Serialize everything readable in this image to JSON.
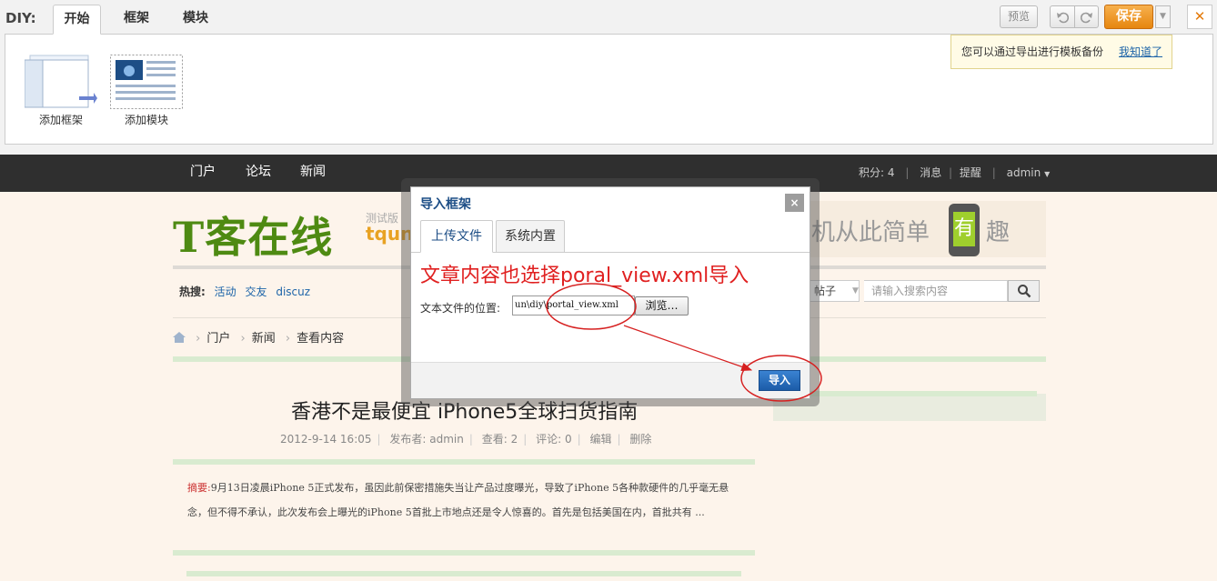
{
  "diy": {
    "label": "DIY:",
    "tabs": [
      "开始",
      "框架",
      "模块"
    ],
    "tools": [
      {
        "label": "添加框架",
        "icon": "frame-icon"
      },
      {
        "label": "添加模块",
        "icon": "module-icon"
      }
    ],
    "preview_label": "预览",
    "undo_icon": "undo-icon",
    "redo_icon": "redo-icon",
    "save_label": "保存",
    "save_menu_icon": "chevron-down-icon",
    "close_icon": "close-icon",
    "backup_tip": "您可以通过导出进行模板备份",
    "backup_tip_link": "我知道了"
  },
  "nav": {
    "items": [
      "门户",
      "论坛",
      "新闻"
    ],
    "user": {
      "points": "积分: 4",
      "messages": "消息",
      "reminders": "提醒",
      "username": "admin"
    }
  },
  "site": {
    "logo_text": "T客在线",
    "logo_badge": "测试版",
    "logo_domain": "tqun.",
    "banner_text": "机从此简单",
    "banner_glyph": "有",
    "banner_tail": "趣"
  },
  "hotbar": {
    "label": "热搜:",
    "links": [
      "活动",
      "交友",
      "discuz"
    ]
  },
  "search": {
    "type": "帖子",
    "placeholder": "请输入搜索内容"
  },
  "breadcrumb": [
    "门户",
    "新闻",
    "查看内容"
  ],
  "article": {
    "title": "香港不是最便宜 iPhone5全球扫货指南",
    "date": "2012-9-14 16:05",
    "author": "发布者: admin",
    "views": "查看: 2",
    "comments": "评论: 0",
    "edit": "编辑",
    "delete": "删除",
    "summary_label": "摘要:",
    "summary": "9月13日凌晨iPhone 5正式发布，虽因此前保密措施失当让产品过度曝光，导致了iPhone 5各种款硬件的几乎毫无悬念，但不得不承认，此次发布会上曝光的iPhone 5首批上市地点还是令人惊喜的。首先是包括美国在内，首批共有 ..."
  },
  "dialog": {
    "title": "导入框架",
    "tabs": [
      "上传文件",
      "系统内置"
    ],
    "annotation": "文章内容也选择poral_view.xml导入",
    "file_label": "文本文件的位置:",
    "file_path": "un\\diy\\portal_view.xml",
    "browse_label": "浏览…",
    "import_label": "导入",
    "close_label": "×"
  },
  "colors": {
    "accent_orange": "#e6860f",
    "nav_bg": "#2f2f2f",
    "link_blue": "#1d64a8",
    "annotation_red": "#e02020",
    "logo_green": "#4e8a12"
  }
}
